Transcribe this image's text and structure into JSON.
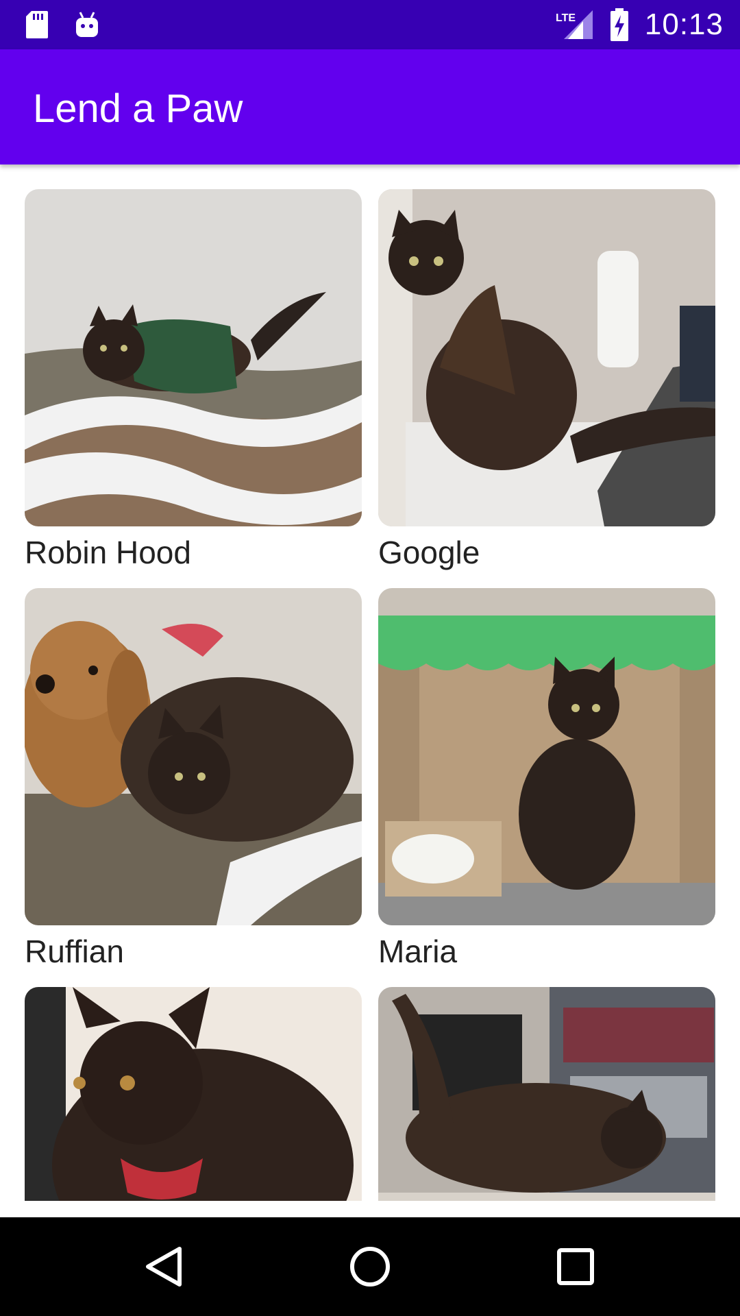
{
  "status_bar": {
    "time": "10:13",
    "network": "LTE",
    "left_icons": [
      "sd-card-icon",
      "android-debug-icon"
    ],
    "right_icons": [
      "lte-signal-icon",
      "battery-charging-icon"
    ]
  },
  "app_bar": {
    "title": "Lend a Paw"
  },
  "cats": [
    {
      "name": "Robin Hood"
    },
    {
      "name": "Google"
    },
    {
      "name": "Ruffian"
    },
    {
      "name": "Maria"
    },
    {
      "name": ""
    },
    {
      "name": ""
    }
  ],
  "nav_bar": {
    "buttons": [
      "back-icon",
      "home-icon",
      "recents-icon"
    ]
  },
  "colors": {
    "status_bar": "#3700b3",
    "app_bar": "#6200ee",
    "nav_bar": "#000000"
  }
}
